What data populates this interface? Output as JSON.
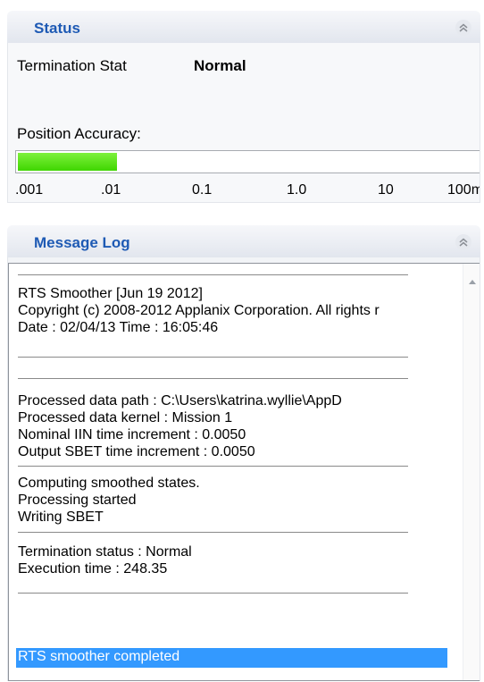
{
  "status_panel": {
    "title": "Status",
    "termination_label": "Termination Stat",
    "termination_value": "Normal",
    "accuracy_label": "Position Accuracy:",
    "accuracy_fill_fraction": 0.215,
    "accuracy_fill_color": "#44dd00",
    "ticks": [
      ".001",
      ".01",
      "0.1",
      "1.0",
      "10",
      "100m"
    ]
  },
  "message_log": {
    "title": "Message Log",
    "lines": [
      "RTS Smoother [Jun 19 2012]",
      "Copyright (c) 2008-2012 Applanix Corporation.  All rights r",
      "Date : 02/04/13    Time : 16:05:46",
      "Processed data path        : C:\\Users\\katrina.wyllie\\AppD",
      "Processed data kernel       : Mission 1",
      "Nominal IIN time increment : 0.0050",
      "Output SBET time increment : 0.0050",
      "Computing smoothed states.",
      "Processing started",
      "Writing SBET",
      "Termination status : Normal",
      "Execution time     : 248.35"
    ],
    "selected_line": "RTS smoother completed",
    "selection_color": "#3399ff"
  },
  "colors": {
    "header_title": "#1e5ab4"
  }
}
